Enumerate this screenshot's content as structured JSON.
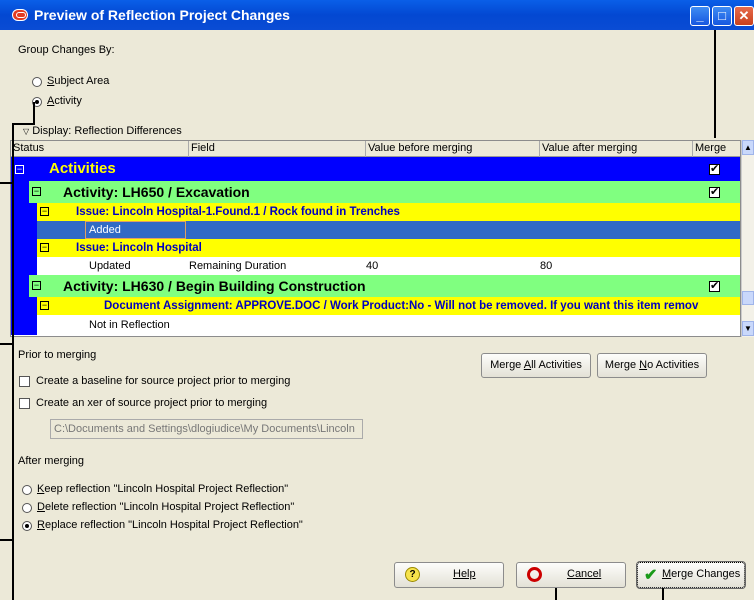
{
  "window": {
    "title": "Preview of Reflection Project Changes"
  },
  "group": {
    "label": "Group Changes By:",
    "subject_area": "Subject Area",
    "activity": "Activity"
  },
  "display_label": "Display: Reflection Differences",
  "grid": {
    "columns": [
      "Status",
      "Field",
      "Value before merging",
      "Value after merging",
      "Merge"
    ],
    "rows": [
      {
        "text": "Activities"
      },
      {
        "text": "Activity: LH650 / Excavation"
      },
      {
        "text": "Issue: Lincoln Hospital-1.Found.1 / Rock found in Trenches"
      },
      {
        "text": "Added"
      },
      {
        "text": "Issue: Lincoln Hospital"
      },
      {
        "status": "Updated",
        "field": "Remaining Duration",
        "before": "40",
        "after": "80"
      },
      {
        "text": "Activity: LH630 / Begin Building Construction"
      },
      {
        "text": "Document Assignment: APPROVE.DOC / Work Product:No - Will not be removed.  If you want this item remov"
      },
      {
        "text": "Not in Reflection"
      }
    ]
  },
  "prior": {
    "label": "Prior to merging",
    "baseline": "Create a baseline for source project prior to merging",
    "xer": "Create an xer of source project prior to merging",
    "path": "C:\\Documents and Settings\\dlogiudice\\My Documents\\Lincoln"
  },
  "merge_all": "Merge All Activities",
  "merge_none": "Merge No Activities",
  "after": {
    "label": "After merging",
    "keep": "Keep reflection \"Lincoln Hospital Project Reflection\"",
    "delete": "Delete reflection \"Lincoln Hospital Project Reflection\"",
    "replace": "Replace reflection \"Lincoln Hospital Project Reflection\""
  },
  "buttons": {
    "help": "Help",
    "cancel": "Cancel",
    "merge": "Merge Changes"
  },
  "colors": {
    "blue": "#0000ff",
    "green": "#80ff80",
    "yellow": "#ffff00",
    "selected": "#316ac5"
  }
}
